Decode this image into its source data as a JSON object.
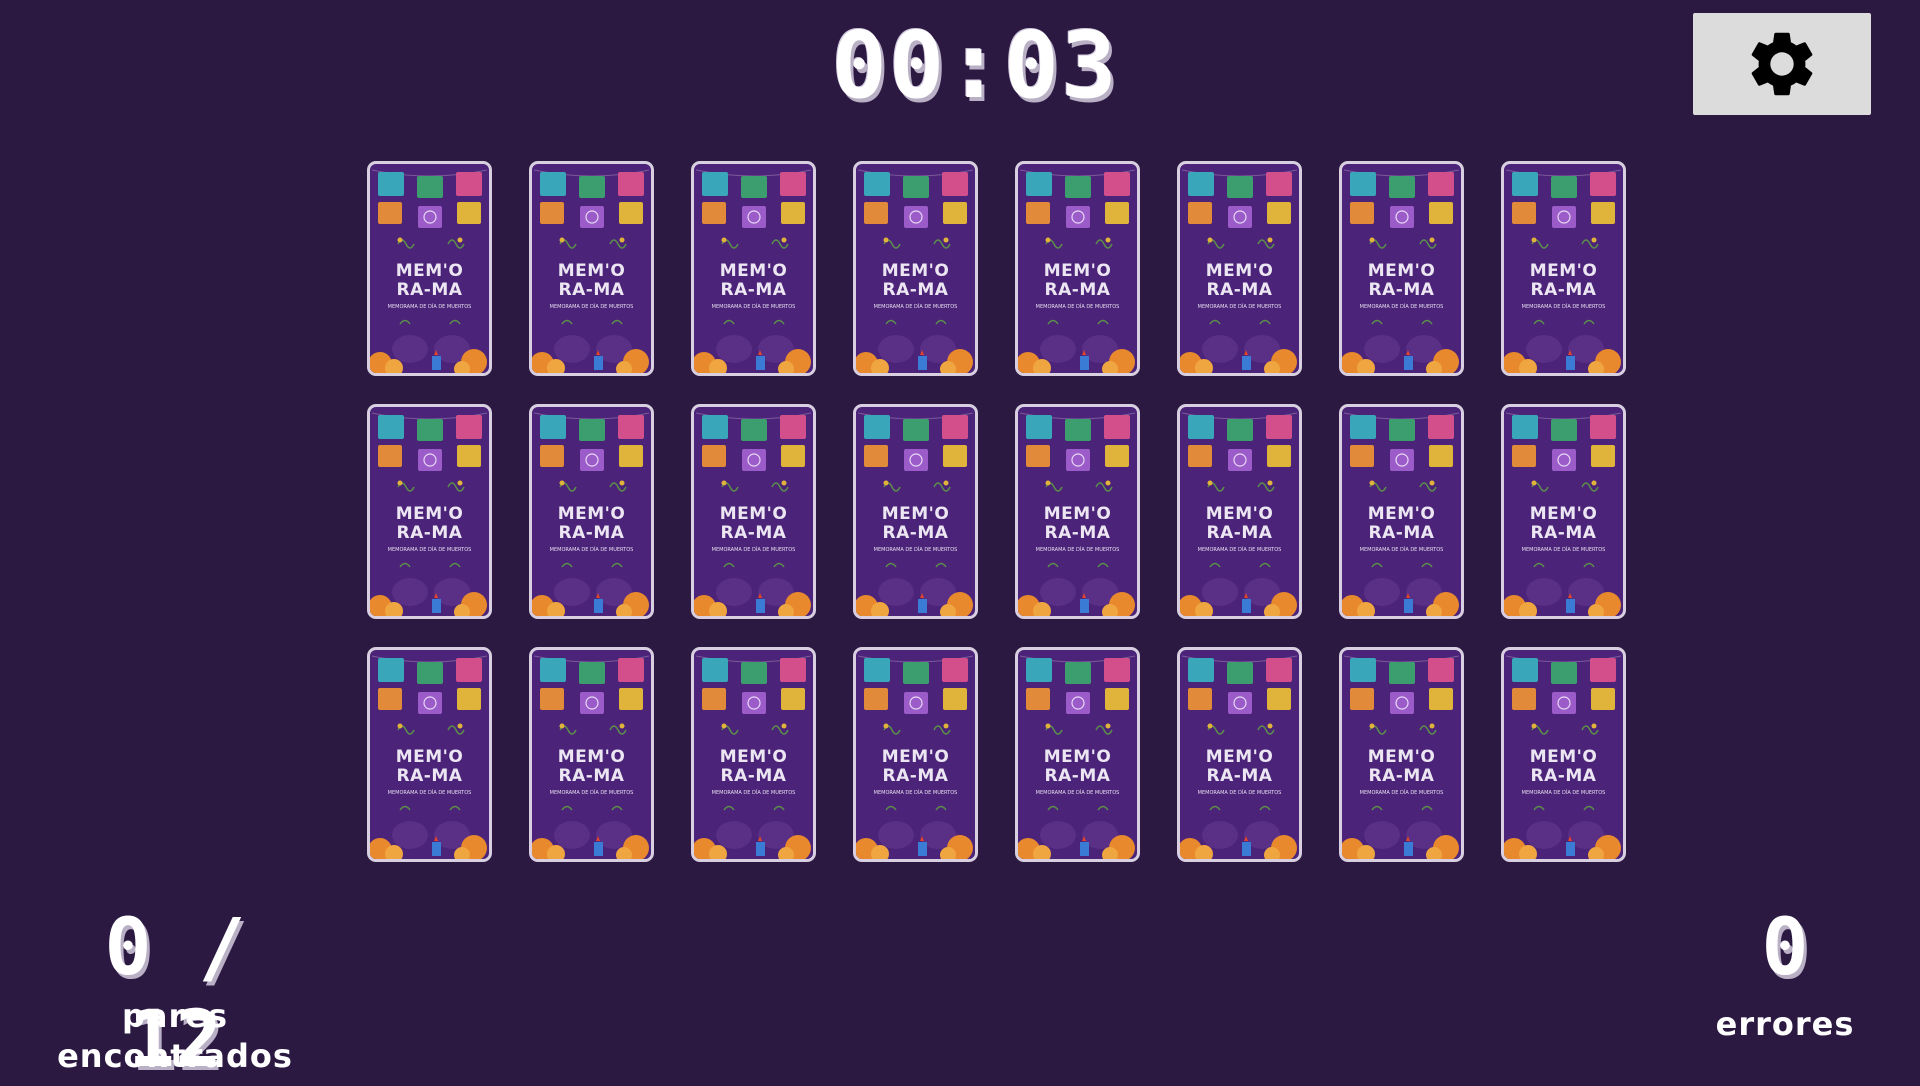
{
  "header": {
    "timer": "00:03",
    "settings_icon": "gear-icon"
  },
  "card_back": {
    "title_line1": "MEM'O",
    "title_line2": "RA-MA",
    "subtitle": "MEMORAMA DE DÍA DE MUERTOS",
    "count": 24,
    "colors": {
      "card_bg": "#4b2378",
      "border": "#d8cfe0",
      "banner": [
        "#3aa6b9",
        "#3c9e6e",
        "#d24f8c",
        "#e08a3a",
        "#9b5cc9",
        "#e0b43a"
      ],
      "marigold": "#e8892e"
    }
  },
  "stats": {
    "pairs_found": "0",
    "pairs_total": "12",
    "pairs_display": "0 / 12",
    "pairs_label_line1": "pares",
    "pairs_label_line2": "encontrados",
    "errors_count": "0",
    "errors_label": "errores"
  },
  "colors": {
    "background": "#2b1942",
    "settings_button": "#dcdcdc"
  }
}
